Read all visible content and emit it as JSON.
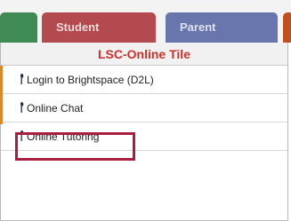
{
  "tabs": [
    {
      "label": ""
    },
    {
      "label": "Student"
    },
    {
      "label": "Parent"
    },
    {
      "label": ""
    }
  ],
  "tile": {
    "title": "LSC-Online Tile",
    "items": [
      {
        "label": "Login to Brightspace (D2L)",
        "icon": "pin-icon"
      },
      {
        "label": "Online Chat",
        "icon": "pin-icon"
      },
      {
        "label": "Online Tutoring",
        "icon": "pin-icon",
        "highlighted": true
      }
    ]
  },
  "colors": {
    "student_tab": "#b24a4f",
    "parent_tab": "#6975ad",
    "title_text": "#c8322d",
    "highlight_border": "#a91e3e"
  }
}
